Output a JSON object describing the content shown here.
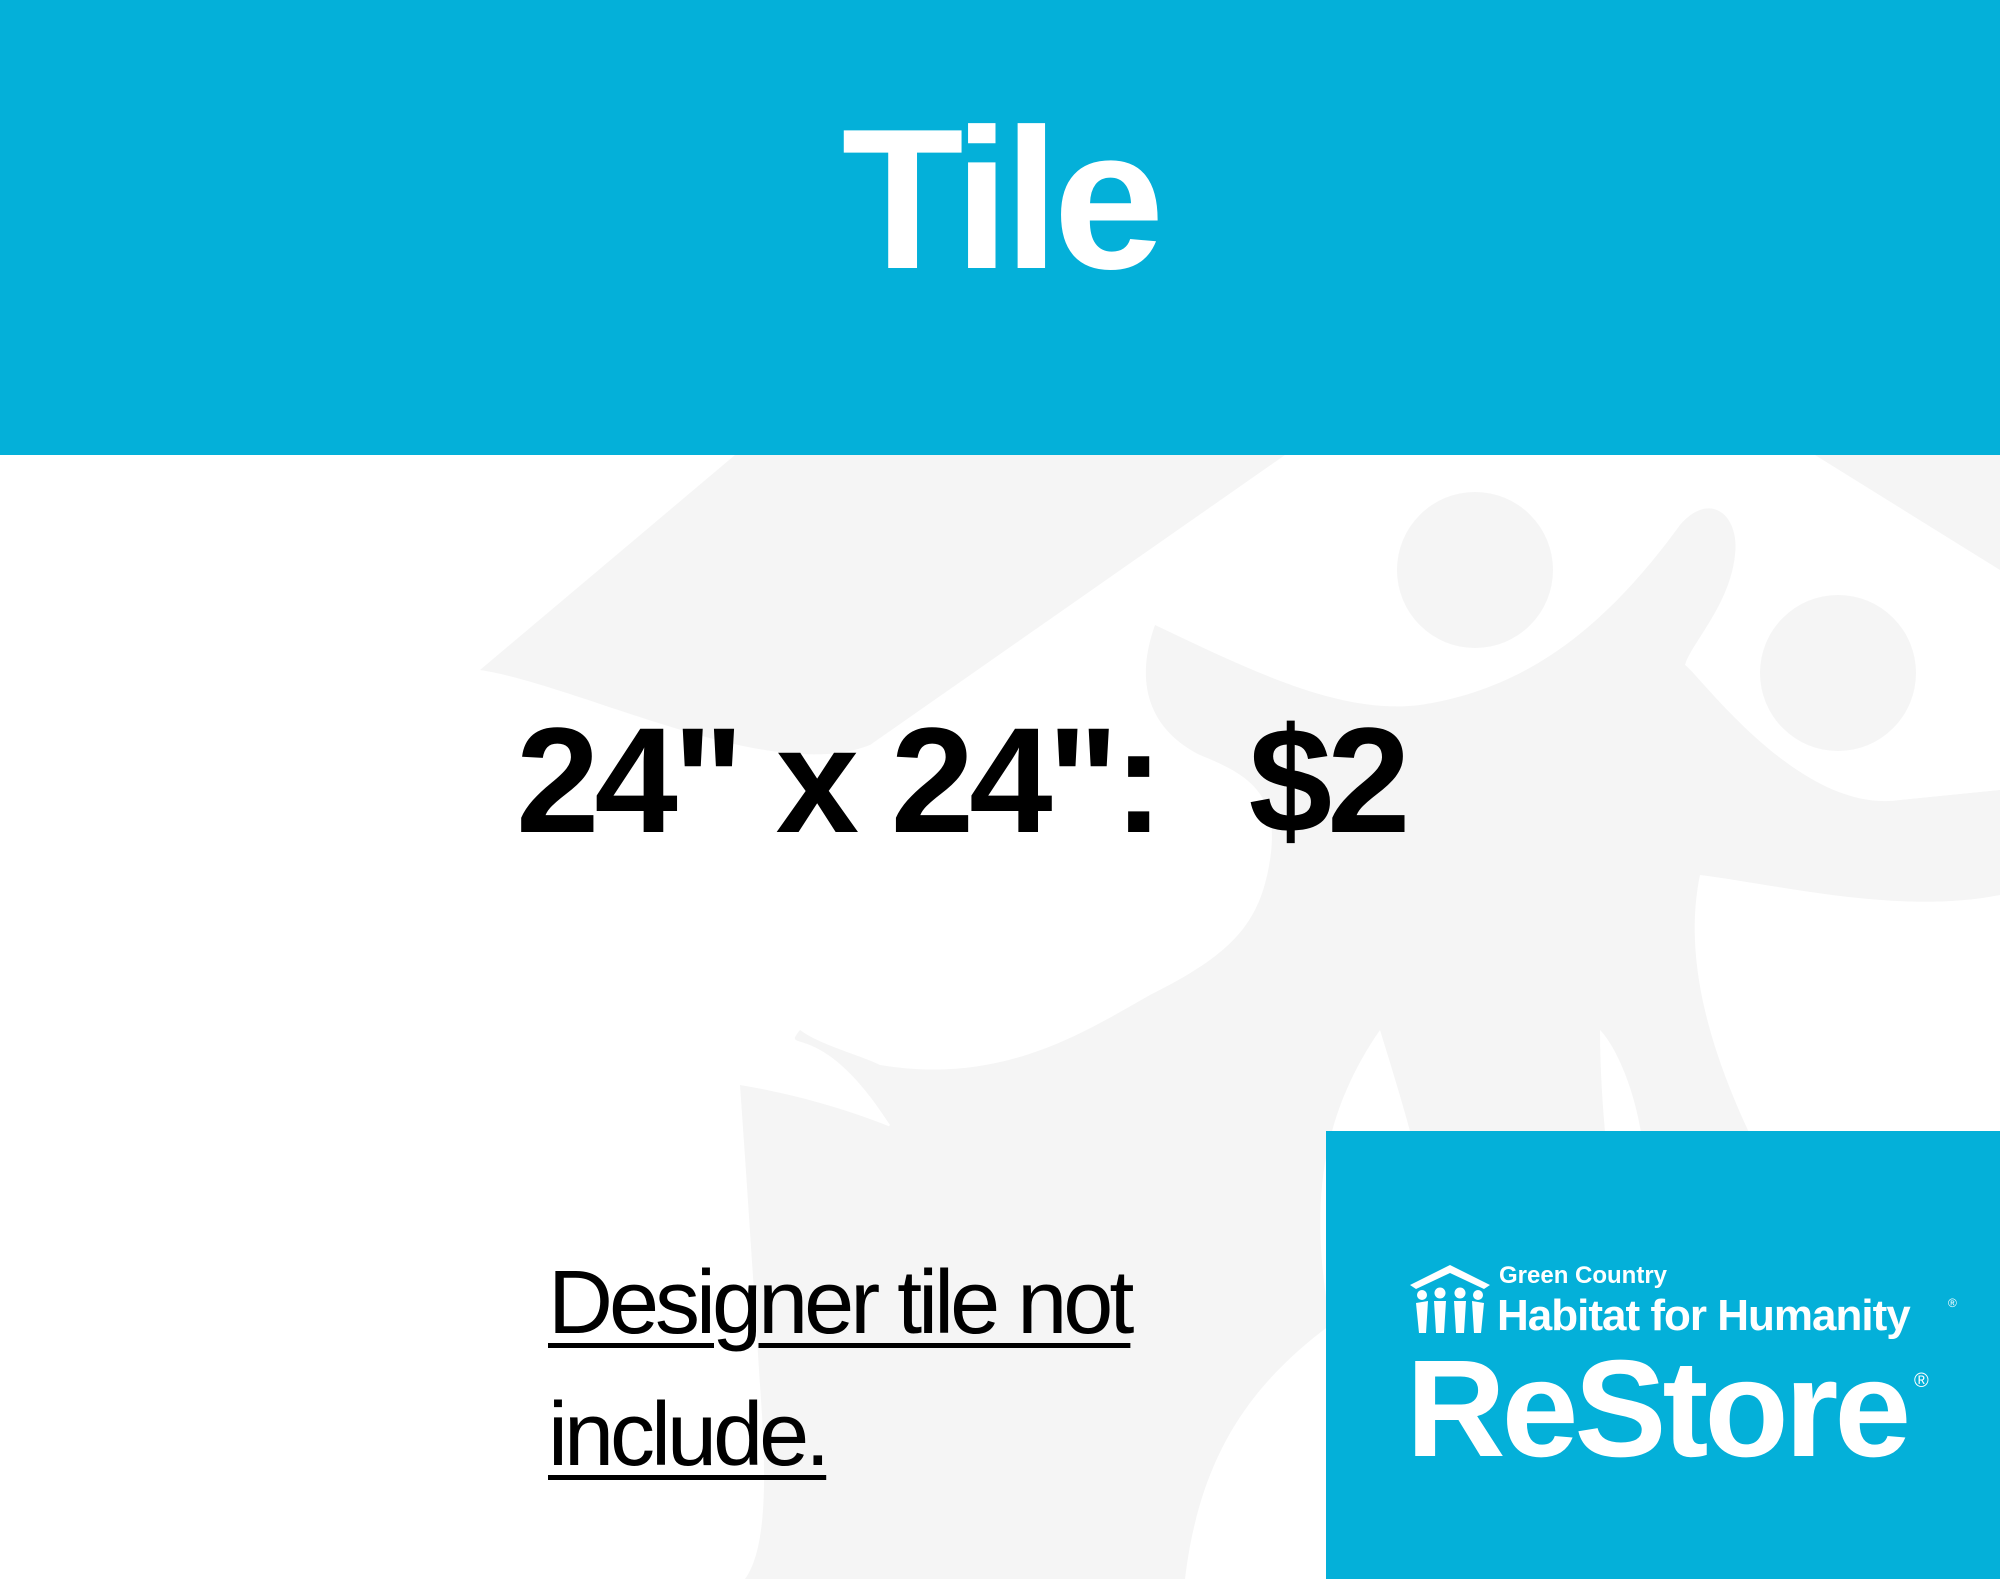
{
  "sign": {
    "title": "Tile",
    "price_size": "24\" x 24\":",
    "price_value": "$2",
    "note": "Designer tile not include."
  },
  "logo": {
    "org_line1": "Green Country",
    "org_line2": "Habitat for Humanity",
    "brand": "ReStore",
    "registered_mark": "®",
    "icon": "habitat-house-people-icon"
  },
  "colors": {
    "brand_blue": "#04b0d9",
    "watermark_gray": "#f5f5f5",
    "text": "#000000",
    "background": "#ffffff"
  }
}
